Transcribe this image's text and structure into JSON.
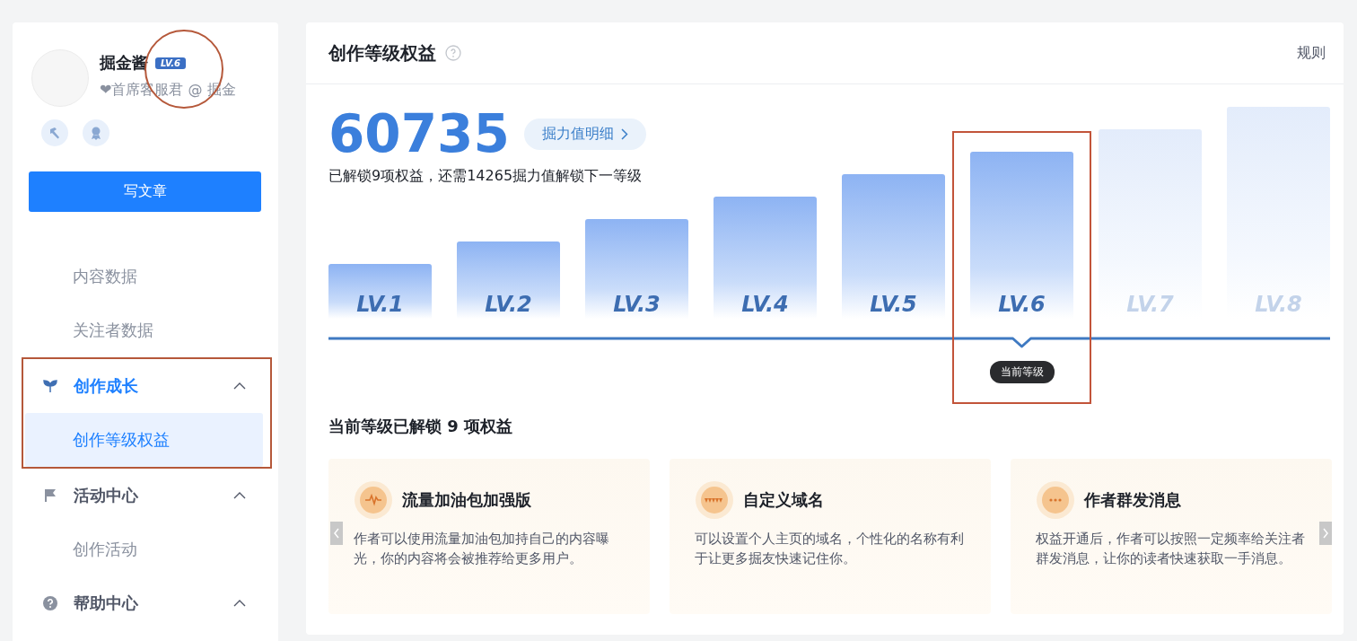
{
  "sidebar": {
    "user": {
      "name": "掘金酱",
      "level_badge": "LV.6",
      "badge_highlighted": true,
      "subtitle": "❤首席客服君 @ 掘金"
    },
    "write_button": "写文章",
    "nav": [
      {
        "kind": "item",
        "label": "内容数据",
        "selected": false
      },
      {
        "kind": "item",
        "label": "关注者数据",
        "selected": false
      },
      {
        "kind": "group",
        "label": "创作成长",
        "active": true,
        "expanded": true,
        "highlighted": true,
        "children": [
          {
            "label": "创作等级权益",
            "selected": true
          }
        ]
      },
      {
        "kind": "group",
        "label": "活动中心",
        "active": false,
        "expanded": true,
        "highlighted": false,
        "children": [
          {
            "label": "创作活动",
            "selected": false
          }
        ]
      },
      {
        "kind": "group",
        "label": "帮助中心",
        "active": false,
        "expanded": true,
        "highlighted": false
      }
    ]
  },
  "main": {
    "title": "创作等级权益",
    "rules_link": "规则",
    "score": "60735",
    "detail_button": "掘力值明细",
    "summary": "已解锁9项权益，还需14265掘力值解锁下一等级",
    "levels": [
      {
        "label": "LV.1",
        "unlocked": true,
        "current": false,
        "highlighted": false
      },
      {
        "label": "LV.2",
        "unlocked": true,
        "current": false,
        "highlighted": false
      },
      {
        "label": "LV.3",
        "unlocked": true,
        "current": false,
        "highlighted": false
      },
      {
        "label": "LV.4",
        "unlocked": true,
        "current": false,
        "highlighted": false
      },
      {
        "label": "LV.5",
        "unlocked": true,
        "current": false,
        "highlighted": false
      },
      {
        "label": "LV.6",
        "unlocked": true,
        "current": true,
        "highlighted": true
      },
      {
        "label": "LV.7",
        "unlocked": false,
        "current": false,
        "highlighted": false
      },
      {
        "label": "LV.8",
        "unlocked": false,
        "current": false,
        "highlighted": false
      }
    ],
    "current_tag": "当前等级",
    "benefits_title": "当前等级已解锁 9 项权益",
    "benefits": [
      {
        "title": "流量加油包加强版",
        "description": "作者可以使用流量加油包加持自己的内容曝光，你的内容将会被推荐给更多用户。"
      },
      {
        "title": "自定义域名",
        "description": "可以设置个人主页的域名，个性化的名称有利于让更多掘友快速记住你。"
      },
      {
        "title": "作者群发消息",
        "description": "权益开通后，作者可以按照一定频率给关注者群发消息，让你的读者快速获取一手消息。"
      }
    ]
  }
}
